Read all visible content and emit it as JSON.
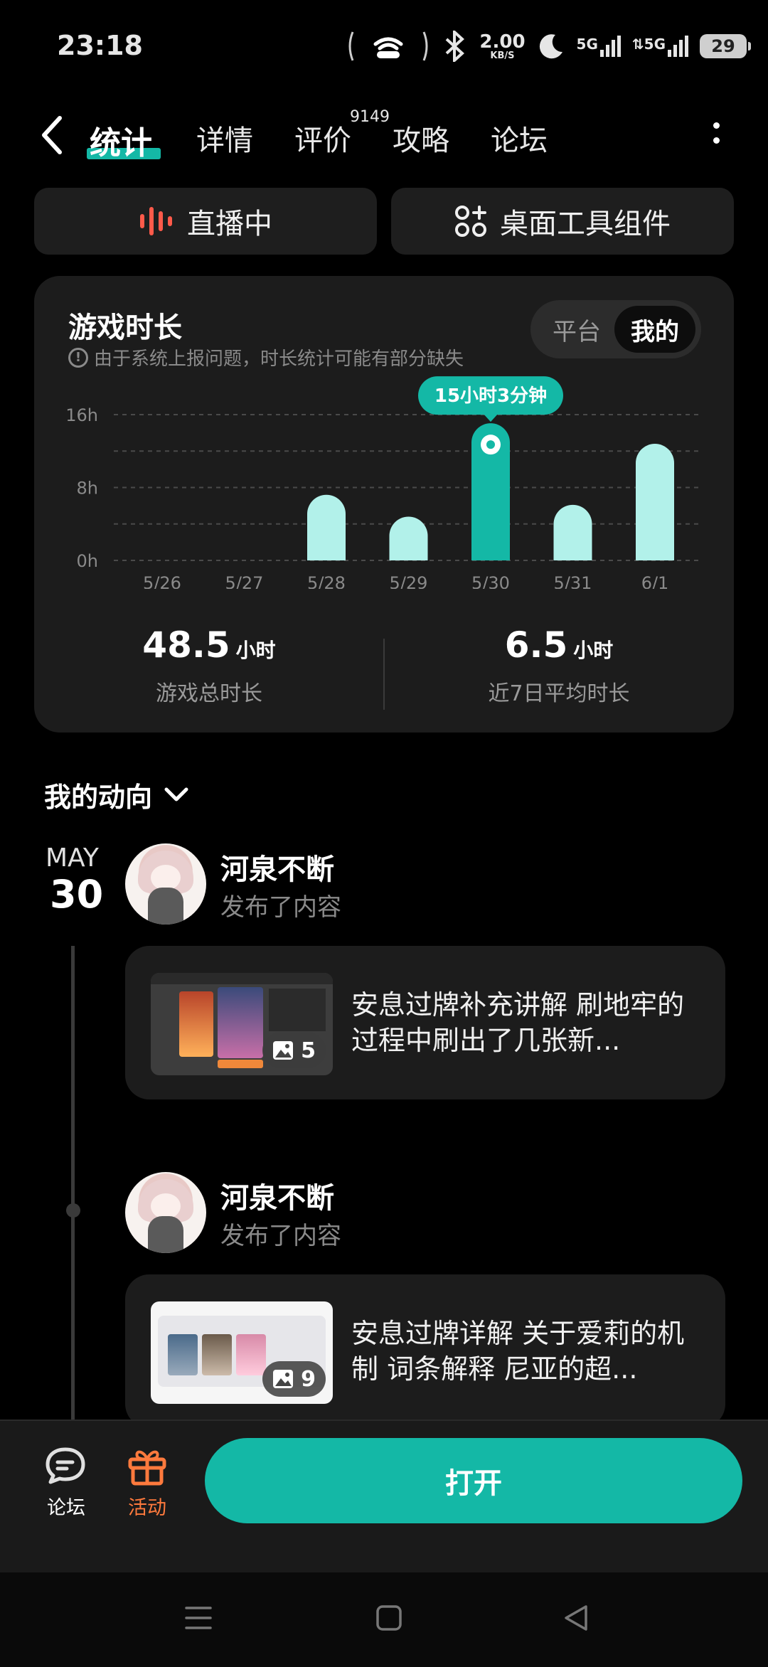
{
  "status": {
    "time": "23:18",
    "net_speed_value": "2.00",
    "net_speed_unit": "KB/S",
    "sim1": "5G",
    "sim2": "5G",
    "battery": "29"
  },
  "nav": {
    "tabs": [
      {
        "label": "统计",
        "active": true
      },
      {
        "label": "详情"
      },
      {
        "label": "评价",
        "badge": "9149"
      },
      {
        "label": "攻略"
      },
      {
        "label": "论坛"
      }
    ]
  },
  "actions": {
    "live_label": "直播中",
    "widget_label": "桌面工具组件"
  },
  "playtime": {
    "title": "游戏时长",
    "note": "由于系统上报问题，时长统计可能有部分缺失",
    "toggle": [
      "平台",
      "我的"
    ],
    "toggle_selected": "我的",
    "highlight_label": "15小时3分钟",
    "total_value": "48.5",
    "total_unit": "小时",
    "total_label": "游戏总时长",
    "avg_value": "6.5",
    "avg_unit": "小时",
    "avg_label": "近7日平均时长"
  },
  "chart_data": {
    "type": "bar",
    "categories": [
      "5/26",
      "5/27",
      "5/28",
      "5/29",
      "5/30",
      "5/31",
      "6/1"
    ],
    "values": [
      0,
      0,
      7.2,
      4.8,
      15.05,
      6.1,
      12.8
    ],
    "y_ticks": [
      "16h",
      "8h",
      "0h"
    ],
    "ylim": [
      0,
      16
    ],
    "highlight_index": 4,
    "grid": true,
    "colors": {
      "bar": "#b2f1ea",
      "highlight": "#14b8a6"
    }
  },
  "feed": {
    "section_title": "我的动向",
    "month": "MAY",
    "day": "30",
    "posts": [
      {
        "user": "河泉不断",
        "action": "发布了内容",
        "image_count": "5",
        "text": "安息过牌补充讲解 刷地牢的过程中刷出了几张新..."
      },
      {
        "user": "河泉不断",
        "action": "发布了内容",
        "image_count": "9",
        "text": "安息过牌详解 关于爱莉的机制 词条解释 尼亚的超..."
      }
    ]
  },
  "bottom": {
    "forum_label": "论坛",
    "activity_label": "活动",
    "open_label": "打开"
  },
  "colors": {
    "accent": "#14b8a6",
    "orange": "#ff7a3d",
    "live_red": "#ff5a4a"
  }
}
